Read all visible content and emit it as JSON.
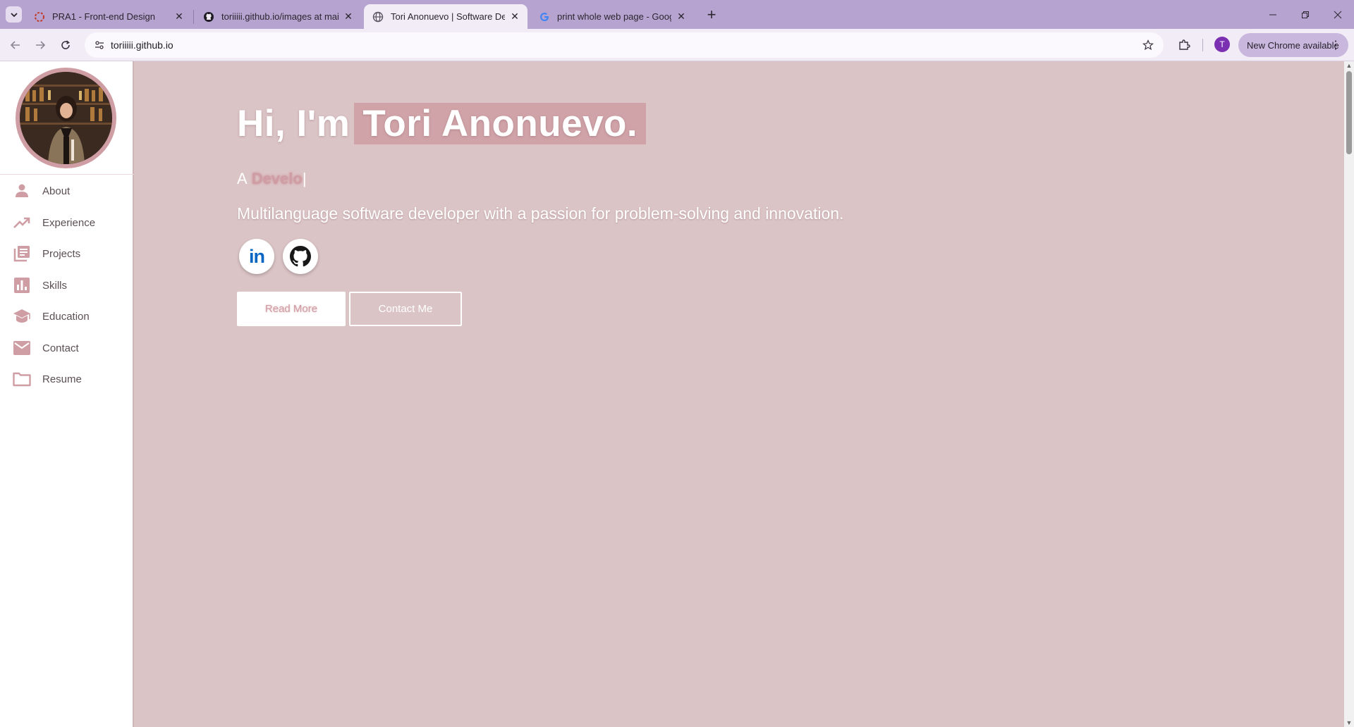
{
  "browser": {
    "tabs": [
      {
        "title": "PRA1 - Front-end Design",
        "icon": "app-icon",
        "active": false
      },
      {
        "title": "toriiiii.github.io/images at main",
        "icon": "github-icon",
        "active": false
      },
      {
        "title": "Tori Anonuevo | Software Devel",
        "icon": "globe-icon",
        "active": true
      },
      {
        "title": "print whole web page - Google",
        "icon": "google-icon",
        "active": false
      }
    ],
    "url": "toriiiii.github.io",
    "profile_initial": "T",
    "update_label": "New Chrome available"
  },
  "sidebar": {
    "items": [
      {
        "label": "About",
        "icon": "person-icon"
      },
      {
        "label": "Experience",
        "icon": "trending-up-icon"
      },
      {
        "label": "Projects",
        "icon": "library-icon"
      },
      {
        "label": "Skills",
        "icon": "bar-chart-icon"
      },
      {
        "label": "Education",
        "icon": "graduation-cap-icon"
      },
      {
        "label": "Contact",
        "icon": "mail-icon"
      },
      {
        "label": "Resume",
        "icon": "folder-icon"
      }
    ]
  },
  "hero": {
    "greeting": "Hi, I'm",
    "name": "Tori Anonuevo.",
    "typed_prefix": "A",
    "typed_word": "Develo",
    "typed_caret": "|",
    "tagline": "Multilanguage software developer with a passion for problem-solving and innovation.",
    "social": [
      {
        "name": "linkedin",
        "label": "in",
        "color": "#0a66c2"
      },
      {
        "name": "github",
        "label": "",
        "color": "#181717"
      }
    ],
    "read_more": "Read More",
    "contact_me": "Contact Me"
  },
  "colors": {
    "accent": "#cf9ea4",
    "page_bg": "#dbc4c6",
    "tab_strip": "#b6a3cf"
  }
}
